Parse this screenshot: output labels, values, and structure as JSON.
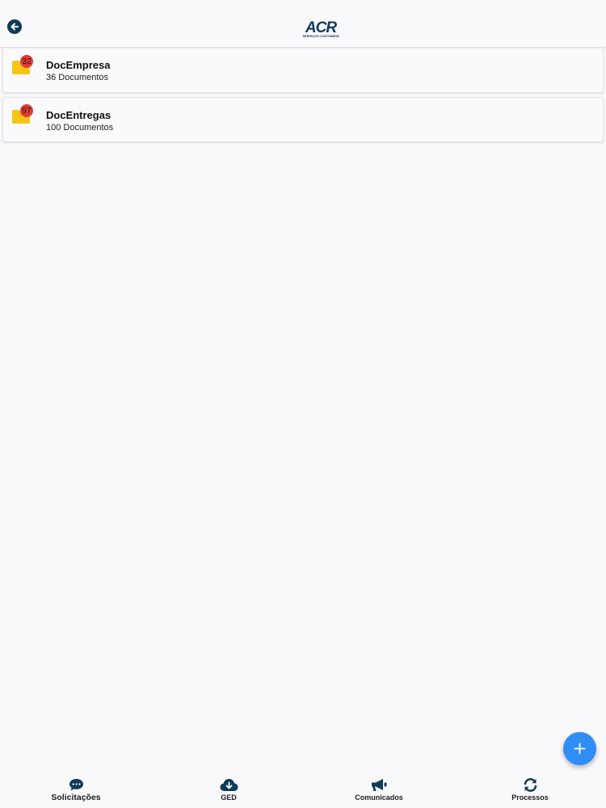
{
  "header": {
    "logo_text": "ACR",
    "logo_subtext": "SERVIÇOS CONTÁBEIS"
  },
  "folders": [
    {
      "name": "DocEmpresa",
      "count_label": "36 Documentos",
      "badge": "32"
    },
    {
      "name": "DocEntregas",
      "count_label": "100 Documentos",
      "badge": "97"
    }
  ],
  "tabs": [
    {
      "label": "Solicitações",
      "icon": "chat-bubble-icon"
    },
    {
      "label": "GED",
      "icon": "cloud-download-icon"
    },
    {
      "label": "Comunicados",
      "icon": "megaphone-icon"
    },
    {
      "label": "Processos",
      "icon": "sync-icon"
    }
  ],
  "colors": {
    "accent": "#2f8ef5",
    "navy": "#0d3b5a",
    "folder": "#f5c518",
    "badge": "#e53935"
  }
}
